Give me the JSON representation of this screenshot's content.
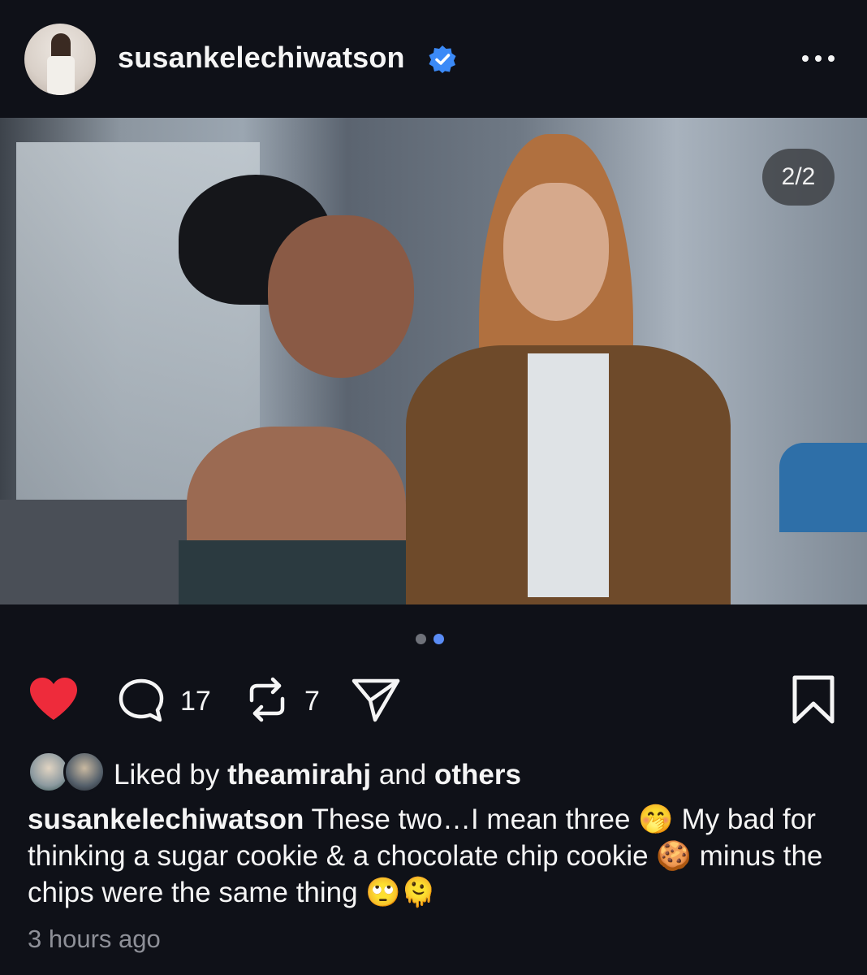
{
  "post": {
    "username": "susankelechiwatson",
    "verified": true,
    "image_counter": "2/2",
    "carousel_dots": 2,
    "carousel_active_index": 1,
    "comment_count": "17",
    "repost_count": "7",
    "liked": true,
    "likes_prefix": "Liked by",
    "likes_user": "theamirahj",
    "likes_and": "and",
    "likes_others": "others",
    "caption_user": "susankelechiwatson",
    "caption_text": "These two…I mean three 🤭  My bad for thinking a sugar cookie & a chocolate chip cookie 🍪 minus the chips were the same thing 🙄🫠",
    "timestamp": "3 hours ago"
  },
  "icons": {
    "verified": "verified-badge-icon",
    "more": "more-options-icon",
    "like": "heart-icon",
    "comment": "comment-icon",
    "repost": "repost-icon",
    "share": "share-icon",
    "bookmark": "bookmark-icon"
  },
  "colors": {
    "background": "#0f1118",
    "like_red": "#ee2b3b",
    "verified_blue": "#3b8af7",
    "active_dot": "#5a8cf5",
    "muted_text": "#8e9098"
  }
}
